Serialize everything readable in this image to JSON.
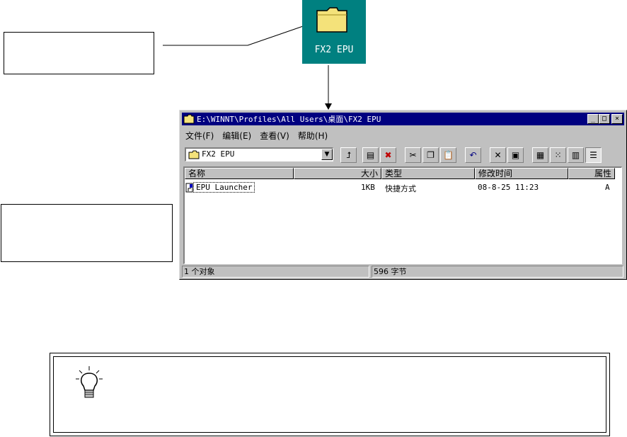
{
  "desktop_icon": {
    "label": "FX2 EPU"
  },
  "window": {
    "title": "E:\\WINNT\\Profiles\\All Users\\桌面\\FX2 EPU",
    "buttons": {
      "minimize": "_",
      "maximize": "□",
      "close": "×"
    },
    "menu": [
      "文件(F)",
      "编辑(E)",
      "查看(V)",
      "帮助(H)"
    ],
    "address": "FX2 EPU",
    "columns": [
      "名称",
      "大小",
      "类型",
      "修改时间",
      "属性"
    ],
    "files": [
      {
        "name": "EPU Launcher",
        "size": "1KB",
        "type": "快捷方式",
        "modified": "08-8-25 11:23",
        "attributes": "A"
      }
    ],
    "status": {
      "objects": "1 个对象",
      "bytes": "596 字节"
    }
  },
  "icons": {
    "toolbar": [
      "up-folder-icon",
      "map-drive-icon",
      "disconnect-drive-icon",
      "cut-icon",
      "copy-icon",
      "paste-icon",
      "undo-icon",
      "delete-icon",
      "properties-icon",
      "large-icons-view",
      "small-icons-view",
      "list-view",
      "details-view"
    ],
    "tip": "lightbulb-icon"
  },
  "colors": {
    "desktop": "#008080",
    "titlebar": "#000080",
    "window": "#c0c0c0"
  }
}
